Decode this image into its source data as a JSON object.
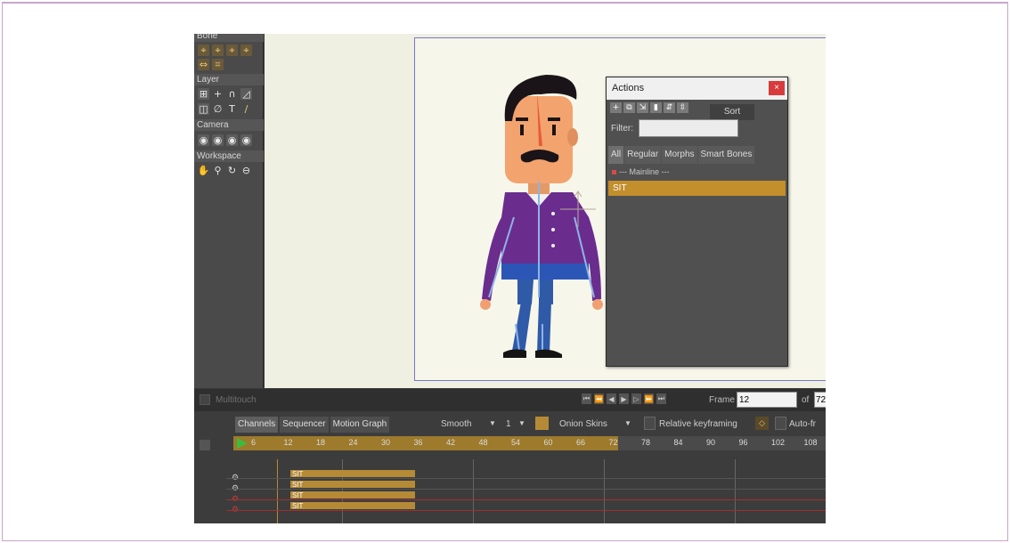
{
  "tools": {
    "bone_section": "Bone",
    "layer_section": "Layer",
    "camera_section": "Camera",
    "workspace_section": "Workspace"
  },
  "actions_window": {
    "title": "Actions",
    "close_glyph": "×",
    "sort_label": "Sort",
    "filter_label": "Filter:",
    "filter_value": "",
    "tabs": [
      {
        "label": "All",
        "active": true
      },
      {
        "label": "Regular",
        "active": false
      },
      {
        "label": "Morphs",
        "active": false
      },
      {
        "label": "Smart Bones",
        "active": false
      }
    ],
    "items": [
      {
        "label": "--- Mainline ---"
      },
      {
        "label": "SIT",
        "selected": true
      }
    ]
  },
  "playbar": {
    "multitouch_label": "Multitouch",
    "frame_label": "Frame",
    "frame_value": "12",
    "of_label": "of",
    "total_frames": "72"
  },
  "timeline": {
    "tabs": [
      {
        "label": "Channels",
        "active": true
      },
      {
        "label": "Sequencer",
        "active": false
      },
      {
        "label": "Motion Graph",
        "active": false
      }
    ],
    "interpolation": "Smooth",
    "interpolation_step": "1",
    "onion_skins_label": "Onion Skins",
    "relative_keyframing_label": "Relative keyframing",
    "auto_label": "Auto-fr",
    "ruler_ticks": [
      "6",
      "12",
      "18",
      "24",
      "30",
      "36",
      "42",
      "48",
      "54",
      "60",
      "66",
      "72",
      "78",
      "84",
      "90",
      "96",
      "102",
      "108"
    ],
    "track_label": "SIT"
  },
  "colors": {
    "accent": "#c38e2c",
    "canvas_frame": "#7877c4",
    "close_red": "#d83b3b"
  }
}
